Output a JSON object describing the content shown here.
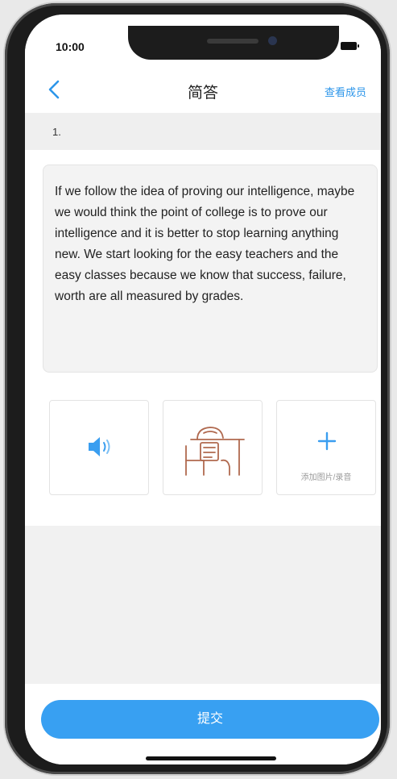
{
  "status": {
    "time": "10:00"
  },
  "nav": {
    "title": "简答",
    "action": "查看成员"
  },
  "question": {
    "number": "1."
  },
  "answer": {
    "text": "If we follow the idea of proving our intelligence, maybe we would think the point of college is to prove our intelligence and it is better to stop learning anything new. We start looking for the easy teachers and the easy classes because we know that success, failure, worth are all measured by grades."
  },
  "tiles": {
    "audio_icon": "speaker-icon",
    "image_icon": "desk-illustration",
    "add_icon": "plus-icon",
    "add_label": "添加图片/录音"
  },
  "footer": {
    "submit_label": "提交"
  },
  "colors": {
    "accent": "#38a0f2",
    "link": "#2d96ea",
    "illustration": "#b0694f"
  }
}
